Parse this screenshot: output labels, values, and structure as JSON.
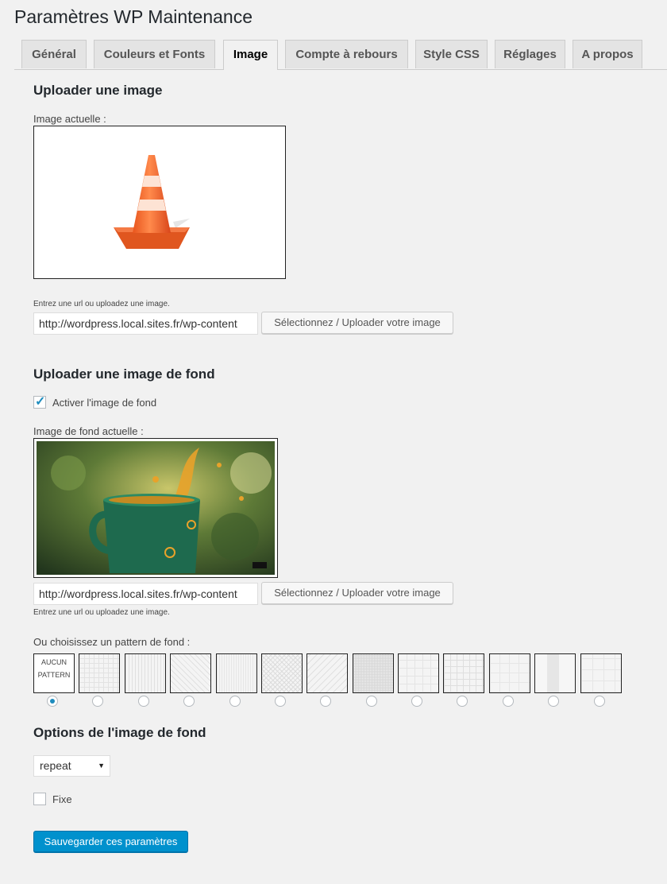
{
  "page": {
    "title": "Paramètres WP Maintenance"
  },
  "tabs": [
    {
      "label": "Général"
    },
    {
      "label": "Couleurs et Fonts"
    },
    {
      "label": "Image",
      "active": true
    },
    {
      "label": "Compte à rebours"
    },
    {
      "label": "Style CSS"
    },
    {
      "label": "Réglages"
    },
    {
      "label": "A propos"
    }
  ],
  "upload_image": {
    "heading": "Uploader une image",
    "current_label": "Image actuelle :",
    "image_icon": "traffic-cone-image",
    "help": "Entrez une url ou uploadez une image.",
    "url_value": "http://wordpress.local.sites.fr/wp-content",
    "button_label": "Sélectionnez / Uploader votre image"
  },
  "background_image": {
    "heading": "Uploader une image de fond",
    "enable_label": "Activer l'image de fond",
    "enable_checked": true,
    "current_label": "Image de fond actuelle :",
    "image_icon": "green-mug-splash-photo",
    "url_value": "http://wordpress.local.sites.fr/wp-content",
    "button_label": "Sélectionnez / Uploader votre image",
    "help": "Entrez une url ou uploadez une image.",
    "pattern_label": "Ou choisissez un pattern de fond :",
    "no_pattern_line1": "AUCUN",
    "no_pattern_line2": "PATTERN",
    "selected_pattern_index": 0
  },
  "bg_options": {
    "heading": "Options de l'image de fond",
    "repeat_value": "repeat",
    "fixed_label": "Fixe",
    "fixed_checked": false
  },
  "save_label": "Sauvegarder ces paramètres",
  "colors": {
    "accent": "#0091cd",
    "cone": "#f0642d",
    "mug": "#1e6a4e"
  }
}
